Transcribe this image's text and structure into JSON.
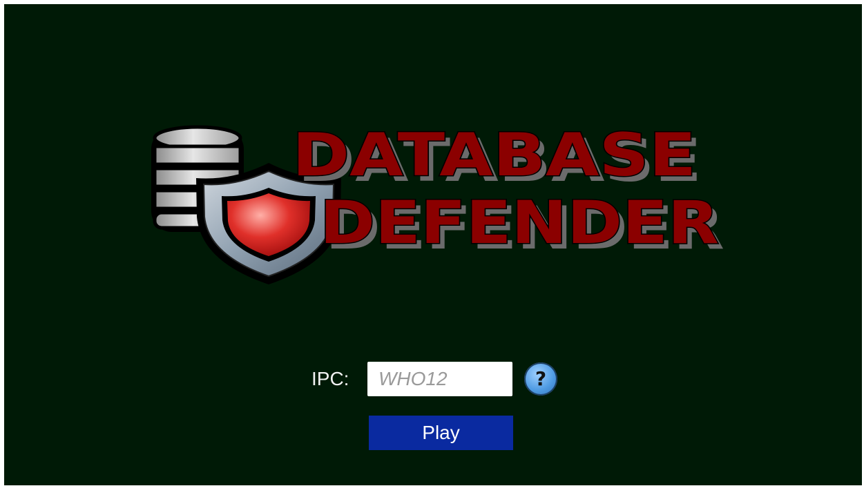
{
  "logo": {
    "line1": "DATABASE",
    "line2": "DEFENDER",
    "database-icon": "database-icon",
    "shield-icon": "shield-icon",
    "text_color": "#8b0000",
    "shadow_color": "#7a7a7a"
  },
  "form": {
    "ipc_label": "IPC:",
    "ipc_placeholder": "WHO12",
    "ipc_value": "",
    "help_label": "?",
    "help_icon": "question-mark-icon"
  },
  "actions": {
    "play_label": "Play"
  },
  "colors": {
    "background": "#001a06",
    "play_button": "#0a2aa0",
    "help_button": "#4f9be3"
  }
}
